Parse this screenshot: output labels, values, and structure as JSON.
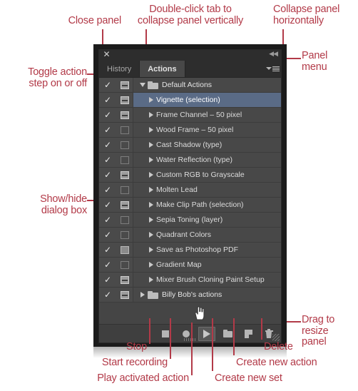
{
  "panel": {
    "close_icon": "✕",
    "collapse_icon": "◀◀",
    "tabs": [
      {
        "label": "History",
        "active": false
      },
      {
        "label": "Actions",
        "active": true
      }
    ],
    "panel_menu_icon": "panel-menu-icon",
    "selected_row_color": "#5a6b86",
    "rows": [
      {
        "check": "✓",
        "dialog": "on",
        "twirl": "down",
        "folder": true,
        "label": "Default Actions",
        "indent": 0,
        "selected": false
      },
      {
        "check": "✓",
        "dialog": "on",
        "twirl": "right",
        "folder": false,
        "label": "Vignette (selection)",
        "indent": 1,
        "selected": true
      },
      {
        "check": "✓",
        "dialog": "on",
        "twirl": "right",
        "folder": false,
        "label": "Frame Channel – 50 pixel",
        "indent": 1,
        "selected": false
      },
      {
        "check": "✓",
        "dialog": "off",
        "twirl": "right",
        "folder": false,
        "label": "Wood Frame – 50 pixel",
        "indent": 1,
        "selected": false
      },
      {
        "check": "✓",
        "dialog": "off",
        "twirl": "right",
        "folder": false,
        "label": "Cast Shadow (type)",
        "indent": 1,
        "selected": false
      },
      {
        "check": "✓",
        "dialog": "off",
        "twirl": "right",
        "folder": false,
        "label": "Water Reflection (type)",
        "indent": 1,
        "selected": false
      },
      {
        "check": "✓",
        "dialog": "on",
        "twirl": "right",
        "folder": false,
        "label": "Custom RGB to Grayscale",
        "indent": 1,
        "selected": false
      },
      {
        "check": "✓",
        "dialog": "off",
        "twirl": "right",
        "folder": false,
        "label": "Molten Lead",
        "indent": 1,
        "selected": false
      },
      {
        "check": "✓",
        "dialog": "on",
        "twirl": "right",
        "folder": false,
        "label": "Make Clip Path (selection)",
        "indent": 1,
        "selected": false
      },
      {
        "check": "✓",
        "dialog": "off",
        "twirl": "right",
        "folder": false,
        "label": "Sepia Toning (layer)",
        "indent": 1,
        "selected": false
      },
      {
        "check": "✓",
        "dialog": "off",
        "twirl": "right",
        "folder": false,
        "label": "Quadrant Colors",
        "indent": 1,
        "selected": false
      },
      {
        "check": "✓",
        "dialog": "grey",
        "twirl": "right",
        "folder": false,
        "label": "Save as Photoshop PDF",
        "indent": 1,
        "selected": false
      },
      {
        "check": "✓",
        "dialog": "off",
        "twirl": "right",
        "folder": false,
        "label": "Gradient Map",
        "indent": 1,
        "selected": false
      },
      {
        "check": "✓",
        "dialog": "on",
        "twirl": "right",
        "folder": false,
        "label": "Mixer Brush Cloning Paint Setup",
        "indent": 1,
        "selected": false
      },
      {
        "check": "✓",
        "dialog": "on",
        "twirl": "right",
        "folder": true,
        "label": "Billy Bob's actions",
        "indent": 0,
        "selected": false
      }
    ],
    "toolbar": [
      {
        "name": "stop-button",
        "icon": "stop-icon",
        "active": false
      },
      {
        "name": "record-button",
        "icon": "record-icon",
        "active": false
      },
      {
        "name": "play-button",
        "icon": "play-icon",
        "active": true
      },
      {
        "name": "create-new-set-button",
        "icon": "folder-icon",
        "active": false
      },
      {
        "name": "create-new-action-button",
        "icon": "new-doc-icon",
        "active": false
      },
      {
        "name": "delete-button",
        "icon": "trash-icon",
        "active": false
      }
    ]
  },
  "annotations": {
    "close_panel": "Close panel",
    "double_click_tab": "Double-click tab to\ncollapse panel vertically",
    "collapse_horizontally": "Collapse panel\nhorizontally",
    "panel_menu": "Panel\nmenu",
    "toggle_action_step": "Toggle action\nstep on or off",
    "show_hide_dialog": "Show/hide\ndialog box",
    "drag_to_resize": "Drag to\nresize\npanel",
    "stop": "Stop",
    "start_recording": "Start recording",
    "play_activated_action": "Play activated action",
    "create_new_set": "Create new set",
    "create_new_action": "Create new action",
    "delete": "Delete",
    "color": "#b23a48"
  }
}
